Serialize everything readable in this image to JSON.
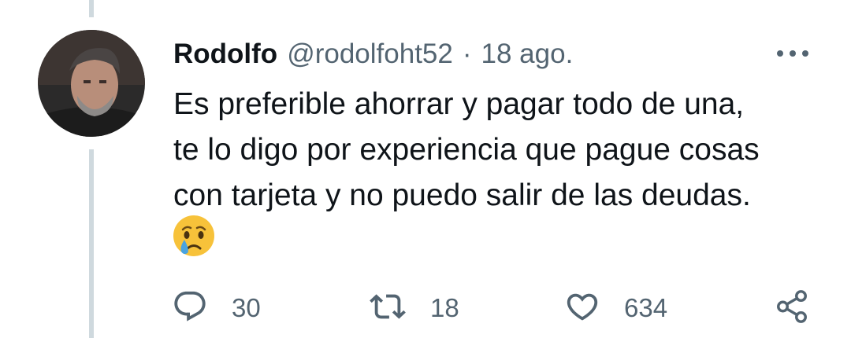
{
  "tweet": {
    "display_name": "Rodolfo",
    "handle": "@rodolfoht52",
    "separator": "·",
    "date": "18 ago.",
    "text_lines": [
      "Es preferible ahorrar y pagar todo de una,",
      "te lo digo por experiencia que pague cosas",
      "con tarjeta y no puedo salir de las deudas."
    ],
    "emoji": "crying-face-emoji"
  },
  "actions": {
    "reply": {
      "icon": "reply-icon",
      "count": "30"
    },
    "retweet": {
      "icon": "retweet-icon",
      "count": "18"
    },
    "like": {
      "icon": "heart-icon",
      "count": "634"
    },
    "share": {
      "icon": "share-icon"
    }
  },
  "colors": {
    "text": "#0f1419",
    "secondary": "#536471",
    "thread_line": "#cfd9de",
    "emoji_yellow": "#f7c23a",
    "tear_blue": "#4aa3df"
  }
}
